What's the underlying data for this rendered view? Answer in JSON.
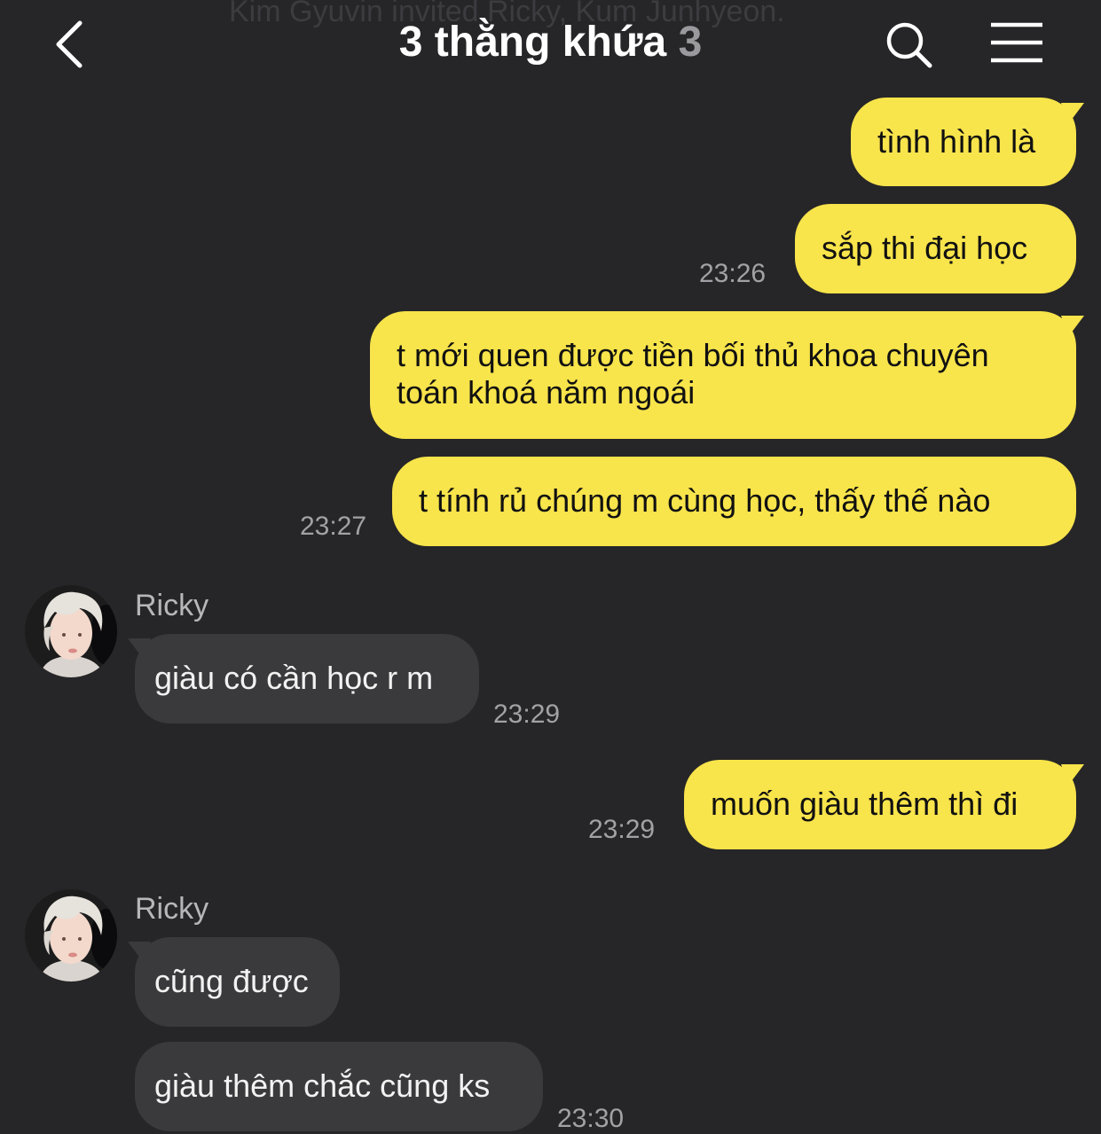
{
  "header": {
    "system_notice": "Kim Gyuvin invited Ricky, Kum Junhyeon.",
    "title": "3 thằng khứa",
    "member_count": "3",
    "back_icon": "chevron-left-icon",
    "search_icon": "search-icon",
    "menu_icon": "hamburger-menu-icon"
  },
  "colors": {
    "background": "#262628",
    "my_bubble": "#f8e44b",
    "their_bubble": "#3a3a3c"
  },
  "messages": [
    {
      "sender": "me",
      "text": "tình hình là",
      "time": ""
    },
    {
      "sender": "me",
      "text": "sắp thi đại học",
      "time": "23:26"
    },
    {
      "sender": "me",
      "lines": [
        "t mới quen được tiền bối thủ khoa chuyên",
        "toán khoá năm ngoái"
      ],
      "time": ""
    },
    {
      "sender": "me",
      "text": "t tính rủ chúng m cùng học, thấy thế nào",
      "time": "23:27"
    },
    {
      "sender": "Ricky",
      "text": "giàu có cần học r m",
      "time": "23:29"
    },
    {
      "sender": "me",
      "text": "muốn giàu thêm thì đi",
      "time": "23:29"
    },
    {
      "sender": "Ricky",
      "text": "cũng được",
      "time": ""
    },
    {
      "sender": "Ricky",
      "text": "giàu thêm chắc cũng ks",
      "time": "23:30"
    }
  ]
}
